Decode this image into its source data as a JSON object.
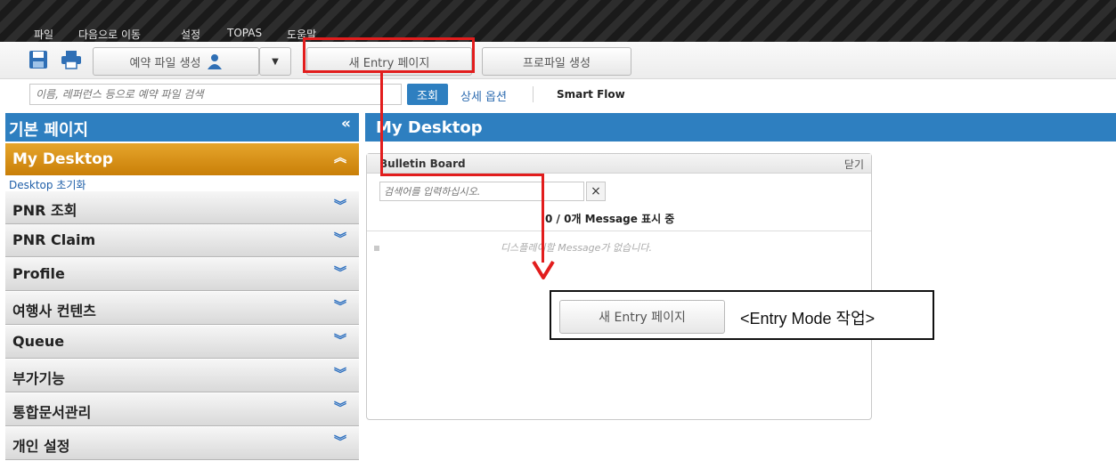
{
  "menu": {
    "file": "파일",
    "goto": "다음으로 이동",
    "settings": "설정",
    "topas": "TOPAS",
    "help": "도움말"
  },
  "toolbar": {
    "reservation_file_create": "예약 파일 생성",
    "new_entry_page": "새 Entry 페이지",
    "profile_create": "프로파일 생성"
  },
  "search": {
    "placeholder": "이름, 레퍼런스 등으로 예약 파일 검색",
    "submit": "조회",
    "detail_options": "상세 옵션",
    "smart_flow": "Smart Flow"
  },
  "sidebar": {
    "title": "기본 페이지",
    "collapse": "«",
    "desktop_section": "My Desktop",
    "desktop_reset": "Desktop 초기화",
    "items": [
      {
        "label": "PNR 조회"
      },
      {
        "label": "PNR Claim"
      },
      {
        "label": "Profile"
      },
      {
        "label": "여행사 컨텐츠"
      },
      {
        "label": "Queue"
      },
      {
        "label": "부가기능"
      },
      {
        "label": "통합문서관리"
      },
      {
        "label": "개인 설정"
      }
    ]
  },
  "main": {
    "title": "My Desktop",
    "bulletin": {
      "title": "Bulletin Board",
      "close": "닫기",
      "search_placeholder": "검색어를 입력하십시오.",
      "clear": "×",
      "count": "0 / 0개 Message 표시 중",
      "empty": "디스플레이할 Message가 없습니다."
    }
  },
  "annotation": {
    "button_label": "새 Entry 페이지",
    "caption": "<Entry Mode 작업>"
  },
  "colors": {
    "header_blue": "#2e7fc0",
    "desktop_orange": "#d68a0c",
    "annotation_red": "#e21d1d"
  }
}
